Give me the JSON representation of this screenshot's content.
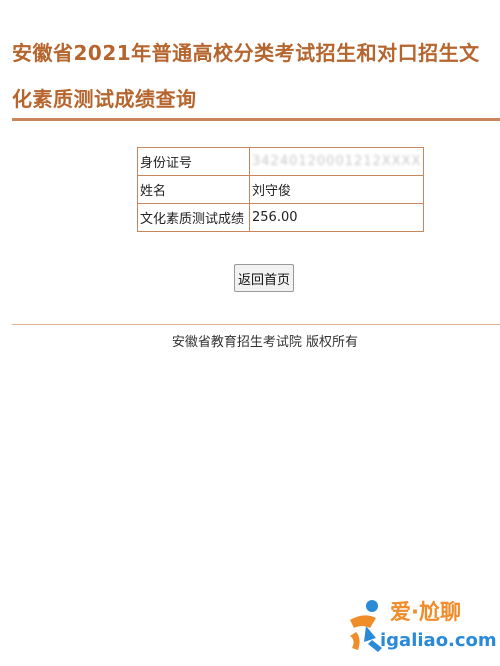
{
  "colors": {
    "accent": "#c8865a",
    "title": "#b5652d",
    "watermark_orange": "#f08c2a",
    "watermark_blue": "#2a8ad8"
  },
  "header": {
    "title_line1": "安徽省2021年普通高校分类考试招生和对口招生文",
    "title_line2": "化素质测试成绩查询"
  },
  "result": {
    "rows": [
      {
        "label": "身份证号",
        "value": "34240120001212XXXX"
      },
      {
        "label": "姓名",
        "value": "刘守俊"
      },
      {
        "label": "文化素质测试成绩",
        "value": "256.00"
      }
    ]
  },
  "actions": {
    "back_label": "返回首页"
  },
  "footer": {
    "copyright": "安徽省教育招生考试院 版权所有"
  },
  "watermark": {
    "brand": "爱·尬聊",
    "url": "igaliao.com"
  }
}
